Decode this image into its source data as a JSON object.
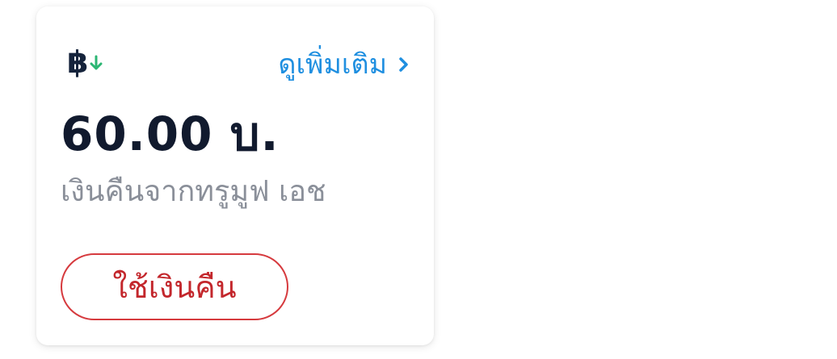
{
  "card": {
    "currency_symbol": "฿",
    "currency_icon": "baht-cashback-icon",
    "arrow_icon": "arrow-down-icon",
    "arrow_color": "#2bb673",
    "more_link_label": "ดูเพิ่มเติม",
    "more_link_color": "#1f8fe0",
    "amount": "60.00 บ.",
    "subtitle": "เงินคืนจากทรูมูฟ เอช",
    "use_button_label": "ใช้เงินคืน",
    "use_button_color": "#d63a3e"
  }
}
